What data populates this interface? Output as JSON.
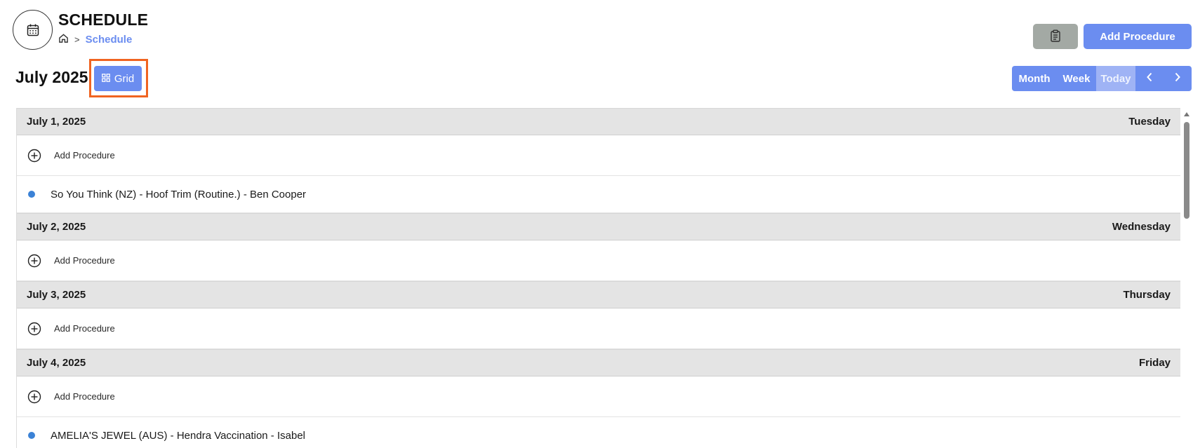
{
  "header": {
    "title": "SCHEDULE",
    "breadcrumb": {
      "home_icon": "home-icon",
      "separator": ">",
      "current": "Schedule"
    },
    "app_icon": "calendar-icon",
    "actions": {
      "clipboard_icon": "clipboard-icon",
      "add_procedure": "Add Procedure"
    }
  },
  "toolbar": {
    "month_label": "July 2025",
    "grid_button": "Grid",
    "views": {
      "month": "Month",
      "week": "Week",
      "today": "Today"
    },
    "nav": {
      "prev_icon": "chevron-left-icon",
      "next_icon": "chevron-right-icon"
    }
  },
  "days": [
    {
      "date": "July 1, 2025",
      "weekday": "Tuesday",
      "add_label": "Add Procedure",
      "events": [
        "So You Think (NZ) - Hoof Trim (Routine.) - Ben Cooper"
      ]
    },
    {
      "date": "July 2, 2025",
      "weekday": "Wednesday",
      "add_label": "Add Procedure",
      "events": []
    },
    {
      "date": "July 3, 2025",
      "weekday": "Thursday",
      "add_label": "Add Procedure",
      "events": []
    },
    {
      "date": "July 4, 2025",
      "weekday": "Friday",
      "add_label": "Add Procedure",
      "events": [
        "AMELIA'S JEWEL (AUS) - Hendra Vaccination - Isabel"
      ]
    }
  ],
  "colors": {
    "accent": "#6b8df0",
    "today_button": "#9fb3f5",
    "clipboard_button": "#a3a9a4",
    "highlight": "#f06421",
    "event_dot": "#3b82d6",
    "day_header_bg": "#e4e4e4"
  }
}
